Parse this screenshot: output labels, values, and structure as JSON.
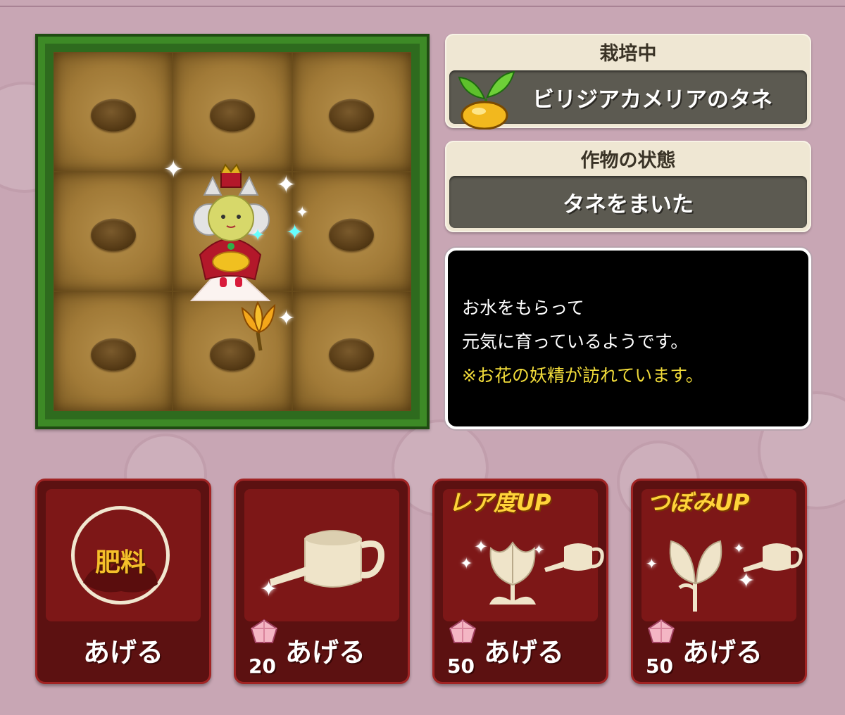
{
  "cultivation": {
    "title": "栽培中",
    "seed_name": "ビリジアカメリアのタネ"
  },
  "crop_status": {
    "title": "作物の状態",
    "value": "タネをまいた"
  },
  "message": {
    "line1": "お水をもらって",
    "line2": "元気に育っているようです。",
    "note": "※お花の妖精が訪れています。"
  },
  "field": {
    "plots": 9,
    "visitor": "flower-fairy"
  },
  "actions": [
    {
      "badge": "肥料",
      "label": "あげる",
      "icon": "fertilizer-icon"
    },
    {
      "label": "あげる",
      "cost": "20",
      "icon": "watering-can-icon"
    },
    {
      "banner": "レア度UP",
      "label": "あげる",
      "cost": "50",
      "icon": "rarity-up-watering-icon"
    },
    {
      "banner": "つぼみUP",
      "label": "あげる",
      "cost": "50",
      "icon": "bud-up-watering-icon"
    }
  ],
  "colors": {
    "background": "#c8a6b4",
    "button": "#7d1717",
    "note": "#f2dc3a"
  }
}
